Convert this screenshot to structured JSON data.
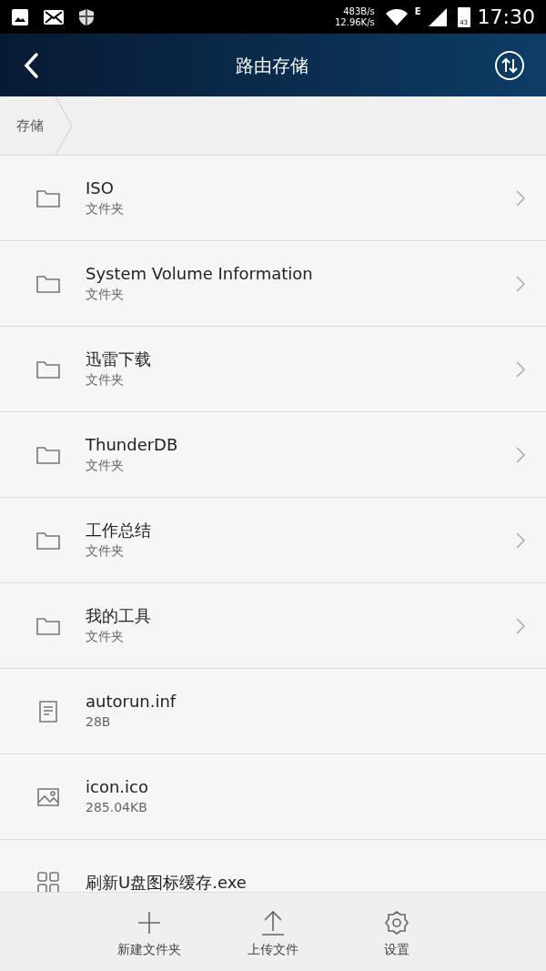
{
  "status_bar": {
    "speed_up": "483B/s",
    "speed_down": "12.96K/s",
    "network": "E",
    "battery": "43",
    "time": "17:30"
  },
  "header": {
    "title": "路由存储"
  },
  "breadcrumb": [
    {
      "label": "存储"
    }
  ],
  "files": [
    {
      "kind": "folder",
      "name": "ISO",
      "detail": "文件夹"
    },
    {
      "kind": "folder",
      "name": "System Volume Information",
      "detail": "文件夹"
    },
    {
      "kind": "folder",
      "name": "迅雷下载",
      "detail": "文件夹"
    },
    {
      "kind": "folder",
      "name": "ThunderDB",
      "detail": "文件夹"
    },
    {
      "kind": "folder",
      "name": "工作总结",
      "detail": "文件夹"
    },
    {
      "kind": "folder",
      "name": "我的工具",
      "detail": "文件夹"
    },
    {
      "kind": "text",
      "name": "autorun.inf",
      "detail": "28B"
    },
    {
      "kind": "image",
      "name": "icon.ico",
      "detail": "285.04KB"
    },
    {
      "kind": "app",
      "name": "刷新U盘图标缓存.exe"
    }
  ],
  "toolbar": [
    {
      "kind": "new-folder",
      "label": "新建文件夹"
    },
    {
      "kind": "upload",
      "label": "上传文件"
    },
    {
      "kind": "settings",
      "label": "设置"
    }
  ]
}
